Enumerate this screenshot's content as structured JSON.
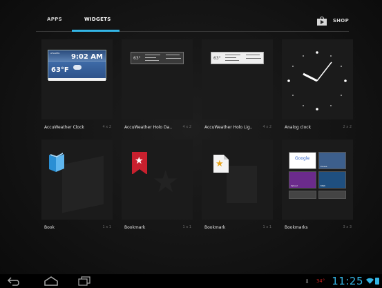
{
  "tabs": {
    "apps_label": "APPS",
    "widgets_label": "WIDGETS",
    "shop_label": "SHOP",
    "active": "WIDGETS"
  },
  "widgets": [
    {
      "name": "AccuWeather Clock",
      "size": "4 x 2",
      "preview": {
        "city": "ATLANTA",
        "time": "9:02 AM",
        "temp": "63°F"
      }
    },
    {
      "name": "AccuWeather Holo Da..",
      "size": "4 x 2",
      "preview": {
        "temp": "63°"
      }
    },
    {
      "name": "AccuWeather Holo Lig..",
      "size": "4 x 2",
      "preview": {
        "temp": "63°"
      }
    },
    {
      "name": "Analog clock",
      "size": "2 x 2"
    },
    {
      "name": "Book",
      "size": "1 x 1"
    },
    {
      "name": "Bookmark",
      "size": "1 x 1"
    },
    {
      "name": "Bookmark",
      "size": "1 x 1"
    },
    {
      "name": "Bookmarks",
      "size": "3 x 3",
      "preview": {
        "tiles": [
          "Google",
          "Picasa",
          "Yahoo!",
          "MSN"
        ]
      }
    }
  ],
  "status_bar": {
    "temperature": "34°",
    "clock": "11:25",
    "icons": [
      "download-icon",
      "wifi-icon",
      "battery-icon"
    ]
  },
  "navigation": {
    "icons": [
      "back-icon",
      "home-icon",
      "recent-apps-icon"
    ]
  },
  "colors": {
    "accent": "#33b5e5",
    "background": "#000000",
    "tile": "#1b1b1b",
    "temp_red": "#c8201e"
  }
}
